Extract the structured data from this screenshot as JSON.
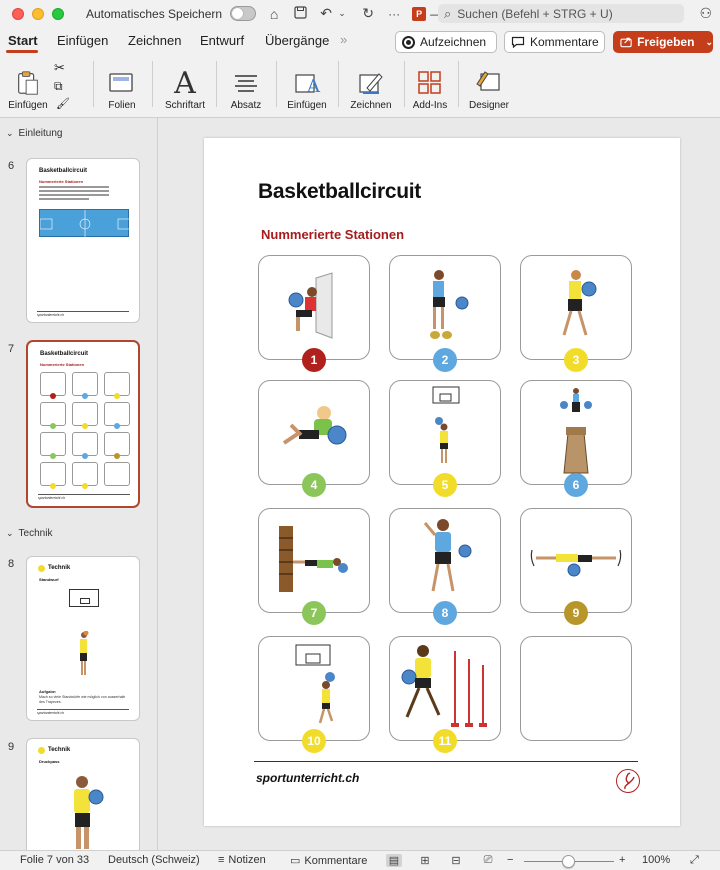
{
  "titlebar": {
    "autosave_label": "Automatisches Speichern",
    "doc_name": "— ...",
    "search_placeholder": "Suchen (Befehl + STRG + U)"
  },
  "tabs": [
    {
      "label": "Start",
      "active": true
    },
    {
      "label": "Einfügen"
    },
    {
      "label": "Zeichnen"
    },
    {
      "label": "Entwurf"
    },
    {
      "label": "Übergänge"
    }
  ],
  "more_tabs": "»",
  "actions": {
    "record_label": "Aufzeichnen",
    "comments_label": "Kommentare",
    "share_label": "Freigeben"
  },
  "ribbon": {
    "groups": [
      "Einfügen",
      "Folien",
      "Schriftart",
      "Absatz",
      "Einfügen",
      "Zeichnen",
      "Add-Ins",
      "Designer"
    ]
  },
  "sidebar": {
    "sections": [
      "Einleitung",
      "Technik"
    ],
    "slides": [
      {
        "number": "6",
        "title": "Basketballcircuit",
        "subtitle": "Nummerierte Stationen",
        "footer": "sportunterricht.ch"
      },
      {
        "number": "7",
        "title": "Basketballcircuit",
        "subtitle": "Nummerierte Stationen",
        "footer": "sportunterricht.ch",
        "selected": true
      },
      {
        "number": "8",
        "title": "Technik",
        "subtitle": "Standwurf",
        "footer": "sportunterricht.ch",
        "task_title": "Aufgabe:",
        "task_text": "Mach so viele Standwürfe wie möglich von ausserhalb des Trapezes."
      },
      {
        "number": "9",
        "title": "Technik",
        "subtitle": "Druckpass"
      }
    ]
  },
  "slide": {
    "title": "Basketballcircuit",
    "subtitle": "Nummerierte Stationen",
    "footer": "sportunterricht.ch",
    "stations": [
      {
        "label": "1",
        "color": "#b0201d"
      },
      {
        "label": "2",
        "color": "#5fa8df"
      },
      {
        "label": "3",
        "color": "#f2dc2a"
      },
      {
        "label": "4",
        "color": "#8cc65a"
      },
      {
        "label": "5",
        "color": "#f2dc2a"
      },
      {
        "label": "6",
        "color": "#5fa8df"
      },
      {
        "label": "7",
        "color": "#8cc65a"
      },
      {
        "label": "8",
        "color": "#5fa8df"
      },
      {
        "label": "9",
        "color": "#b8962a"
      },
      {
        "label": "10",
        "color": "#f2dc2a"
      },
      {
        "label": "11",
        "color": "#f2dc2a"
      },
      {
        "label": "",
        "color": ""
      }
    ]
  },
  "statusbar": {
    "slide_count": "Folie 7 von 33",
    "language": "Deutsch (Schweiz)",
    "notes_label": "Notizen",
    "comments_label": "Kommentare",
    "zoom": "100%"
  }
}
